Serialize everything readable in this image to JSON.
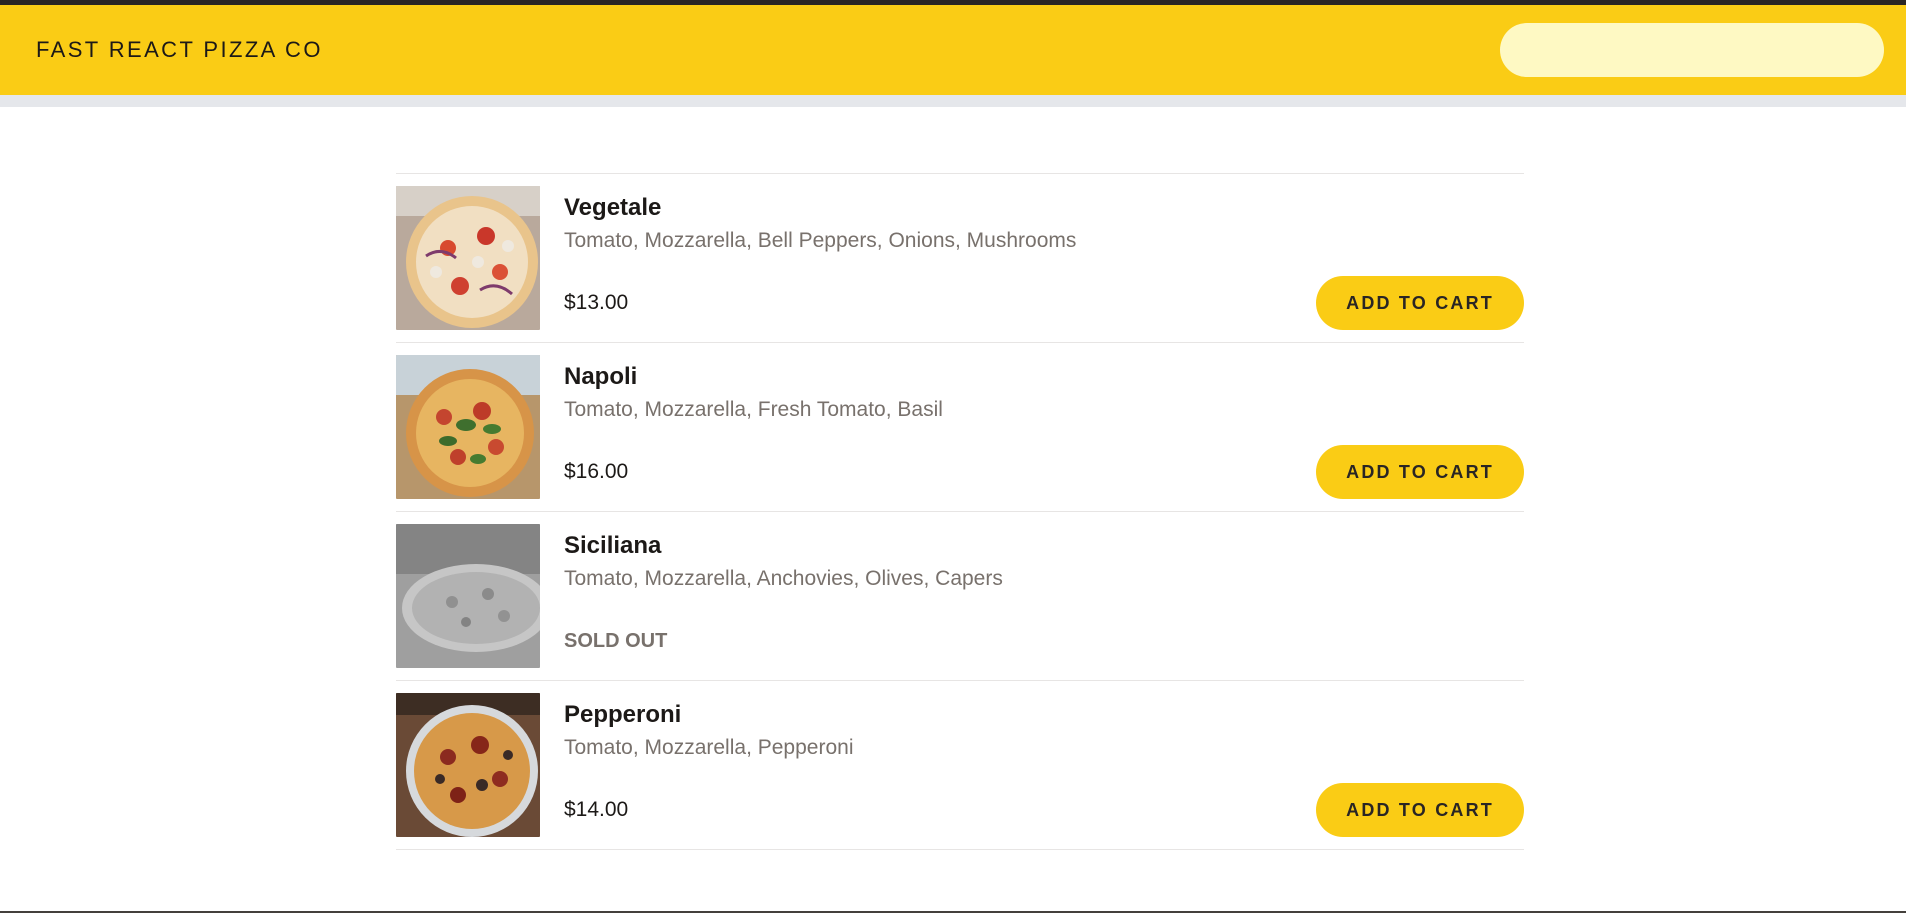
{
  "header": {
    "brand": "FAST REACT PIZZA CO",
    "search_value": ""
  },
  "menu": {
    "items": [
      {
        "name": "Vegetale",
        "ingredients": "Tomato, Mozzarella, Bell Peppers, Onions, Mushrooms",
        "price": "$13.00",
        "sold_out": false,
        "action_label": "ADD TO CART"
      },
      {
        "name": "Napoli",
        "ingredients": "Tomato, Mozzarella, Fresh Tomato, Basil",
        "price": "$16.00",
        "sold_out": false,
        "action_label": "ADD TO CART"
      },
      {
        "name": "Siciliana",
        "ingredients": "Tomato, Mozzarella, Anchovies, Olives, Capers",
        "status": "SOLD OUT",
        "sold_out": true
      },
      {
        "name": "Pepperoni",
        "ingredients": "Tomato, Mozzarella, Pepperoni",
        "price": "$14.00",
        "sold_out": false,
        "action_label": "ADD TO CART"
      }
    ]
  },
  "colors": {
    "brand_yellow": "#facc15",
    "search_bg": "#fef9c3",
    "topbar_dark": "#292524",
    "muted_text": "#78716c"
  }
}
